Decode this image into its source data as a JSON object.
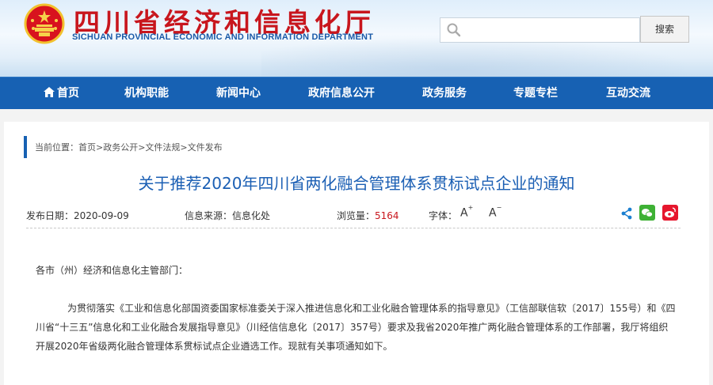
{
  "header": {
    "title": "四川省经济和信息化厅",
    "subtitle": "SICHUAN PROVINCIAL ECONOMIC AND INFORMATION DEPARTMENT",
    "search": {
      "placeholder": "",
      "button_label": "搜索"
    }
  },
  "nav": {
    "items": [
      "首页",
      "机构职能",
      "新闻中心",
      "政府信息公开",
      "政务服务",
      "专题专栏",
      "互动交流"
    ]
  },
  "breadcrumb": "当前位置：首页>政务公开>文件法规>文件发布",
  "article": {
    "title": "关于推荐2020年四川省两化融合管理体系贯标试点企业的通知",
    "meta": {
      "date_label": "发布日期：",
      "date": "2020-09-09",
      "source_label": "信息来源：",
      "source": "信息化处",
      "views_label": "浏览量：",
      "views": "5164",
      "font_label": "字体：",
      "font_increase": "A",
      "font_decrease": "A"
    },
    "greeting": "各市（州）经济和信息化主管部门：",
    "paragraph": "为贯彻落实《工业和信息化部国资委国家标准委关于深入推进信息化和工业化融合管理体系的指导意见》（工信部联信软〔2017〕155号）和《四川省“十三五”信息化和工业化融合发展指导意见》（川经信信息化〔2017〕357号）要求及我省2020年推广两化融合管理体系的工作部署，我厅将组织开展2020年省级两化融合管理体系贯标试点企业遴选工作。现就有关事项通知如下。"
  },
  "colors": {
    "nav_bg": "#1761b3",
    "title_red": "#c8161d",
    "link_blue": "#1b5fb4"
  }
}
